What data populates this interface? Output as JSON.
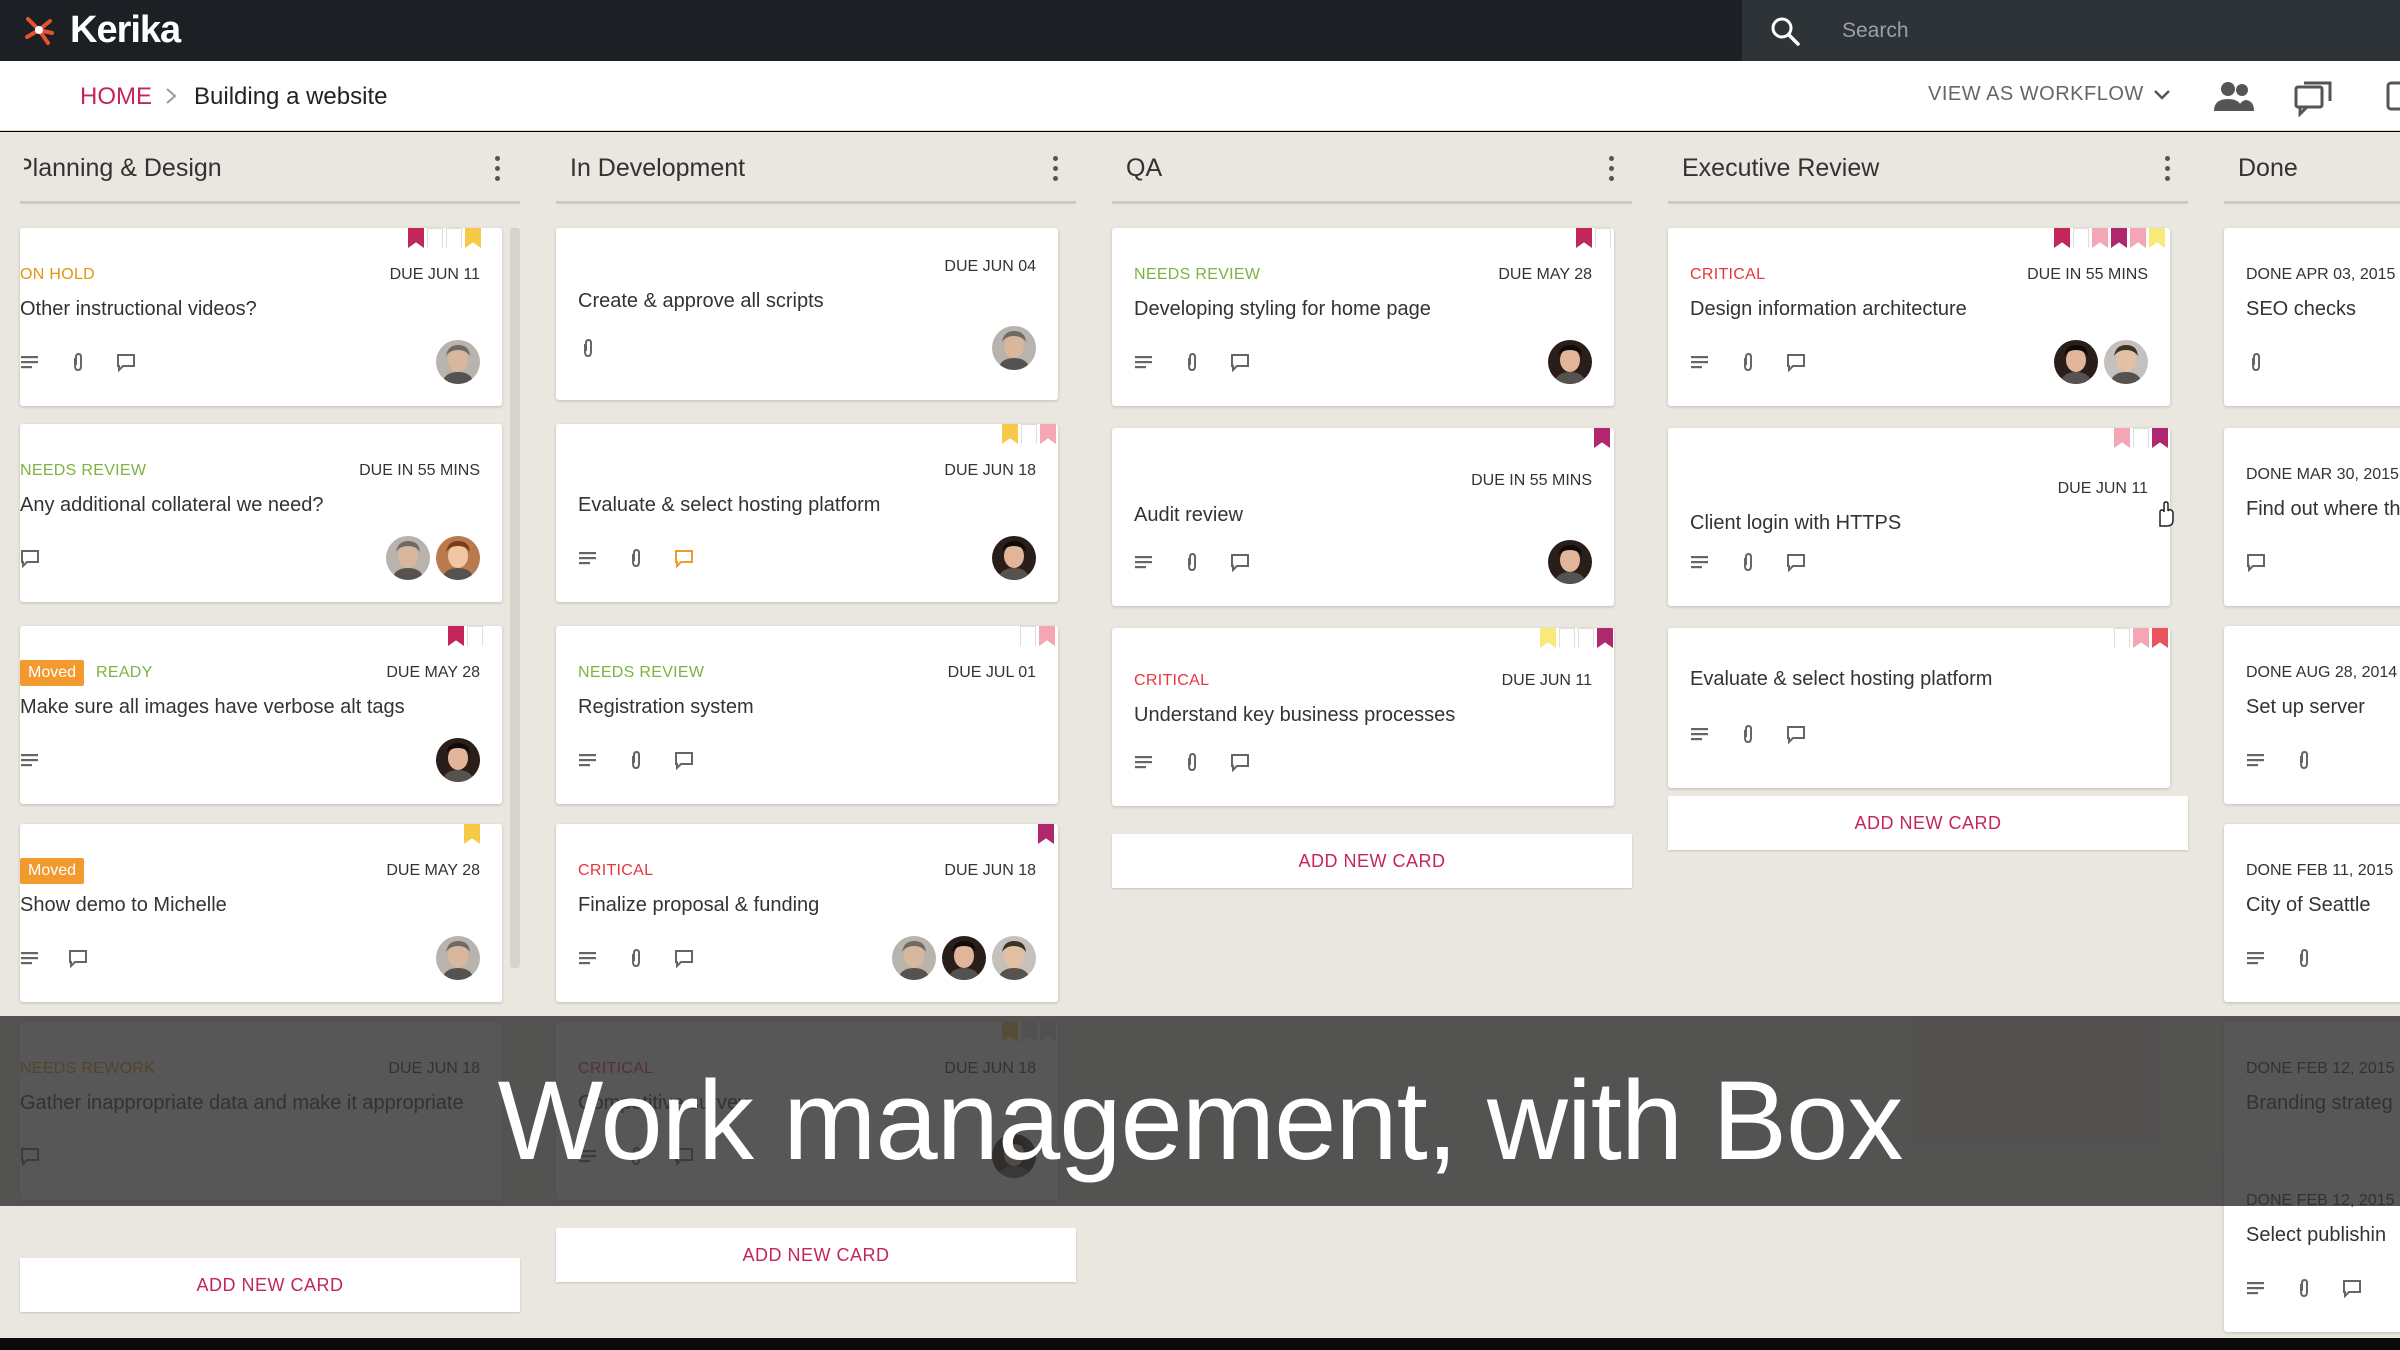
{
  "app": {
    "name": "Kerika",
    "brand_color": "#c4265c"
  },
  "search": {
    "placeholder": "Search"
  },
  "breadcrumb": {
    "home": "HOME",
    "page": "Building a website"
  },
  "header": {
    "view_as": "VIEW AS WORKFLOW"
  },
  "add_card_label": "ADD NEW CARD",
  "caption": "Work management, with Box",
  "columns": [
    {
      "title": "Planning & Design",
      "cards": [
        {
          "status": "ON HOLD",
          "due": "DUE JUN 11",
          "title": "Other instructional videos?"
        },
        {
          "status": "NEEDS REVIEW",
          "due": "DUE IN 55 MINS",
          "title": "Any additional collateral we need?"
        },
        {
          "moved": "Moved",
          "status": "READY",
          "due": "DUE MAY 28",
          "title": "Make sure all images have verbose alt tags"
        },
        {
          "moved": "Moved",
          "status": "",
          "due": "DUE MAY 28",
          "title": "Show demo to Michelle"
        },
        {
          "status": "NEEDS REWORK",
          "due": "DUE JUN 18",
          "title": "Gather inappropriate data and make it appropriate"
        }
      ]
    },
    {
      "title": "In Development",
      "cards": [
        {
          "status": "",
          "due": "DUE JUN 04",
          "title": "Create & approve all scripts"
        },
        {
          "status": "",
          "due": "DUE JUN 18",
          "title": "Evaluate & select hosting platform"
        },
        {
          "status": "NEEDS REVIEW",
          "due": "DUE JUL 01",
          "title": "Registration system"
        },
        {
          "status": "CRITICAL",
          "due": "DUE JUN 18",
          "title": "Finalize proposal & funding"
        },
        {
          "status": "CRITICAL",
          "due": "DUE JUN 18",
          "title": "Competitive survey"
        }
      ]
    },
    {
      "title": "QA",
      "cards": [
        {
          "status": "NEEDS REVIEW",
          "due": "DUE MAY 28",
          "title": "Developing styling for home page"
        },
        {
          "status": "",
          "due": "DUE IN 55 MINS",
          "title": "Audit review"
        },
        {
          "status": "CRITICAL",
          "due": "DUE JUN 11",
          "title": "Understand key business processes"
        }
      ]
    },
    {
      "title": "Executive Review",
      "cards": [
        {
          "status": "CRITICAL",
          "due": "DUE IN 55 MINS",
          "title": "Design information architecture"
        },
        {
          "status": "",
          "due": "DUE JUN 11",
          "title": "Client login with HTTPS"
        },
        {
          "status": "",
          "due": "",
          "title": "Evaluate & select hosting platform"
        }
      ]
    },
    {
      "title": "Done",
      "cards": [
        {
          "due": "DONE APR 03, 2015",
          "title": "SEO checks"
        },
        {
          "due": "DONE MAR 30, 2015",
          "title": "Find out where th"
        },
        {
          "due": "DONE AUG 28, 2014",
          "title": "Set up server"
        },
        {
          "due": "DONE FEB 11, 2015",
          "title": "City of Seattle"
        },
        {
          "due": "DONE FEB 12, 2015",
          "title": "Branding strateg"
        },
        {
          "due": "DONE FEB 12, 2015",
          "title": "Select publishin"
        }
      ]
    }
  ],
  "colors": {
    "on_hold": "#e0960f",
    "needs_review": "#7cb342",
    "ready": "#7cb342",
    "critical": "#e8353e",
    "needs_rework": "#e0960f",
    "moved_badge": "#f29a2e"
  }
}
